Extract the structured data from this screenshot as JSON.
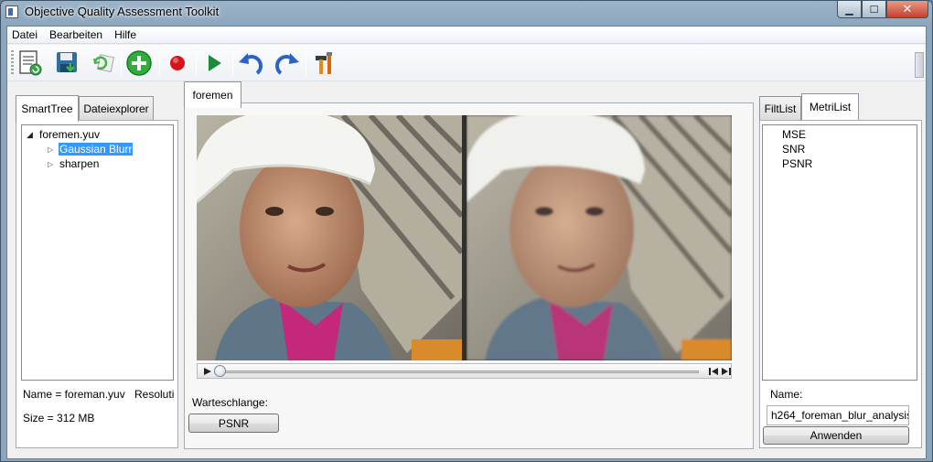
{
  "window": {
    "title": "Objective Quality Assessment Toolkit"
  },
  "menu": [
    "Datei",
    "Bearbeiten",
    "Hilfe"
  ],
  "toolbar": {
    "icons": [
      "new-project-icon",
      "save-icon",
      "refresh-icon",
      "add-icon",
      "record-icon",
      "play-icon",
      "undo-icon",
      "redo-icon",
      "tools-icon"
    ]
  },
  "left_panel": {
    "tabs": [
      "SmartTree",
      "Dateiexplorer"
    ],
    "active_tab": "SmartTree",
    "tree": {
      "root": "foremen.yuv",
      "children": [
        "Gaussian Blurr",
        "sharpen"
      ],
      "selected": "Gaussian Blurr"
    },
    "info": {
      "name_line": "Name = foreman.yuv",
      "resolution_line": "Resoluti",
      "size_line": "Size = 312 MB"
    }
  },
  "center_panel": {
    "tab": "foremen",
    "queue_label": "Warteschlange:",
    "queue_button": "PSNR"
  },
  "right_panel": {
    "tabs": [
      "FiltList",
      "MetriList"
    ],
    "active_tab": "MetriList",
    "metrics": [
      "MSE",
      "SNR",
      "PSNR"
    ],
    "name_label": "Name:",
    "name_value": "h264_foreman_blur_analysis",
    "apply_button": "Anwenden"
  },
  "colors": {
    "selection": "#3399ff",
    "title_bar": "#8aa5bc"
  }
}
